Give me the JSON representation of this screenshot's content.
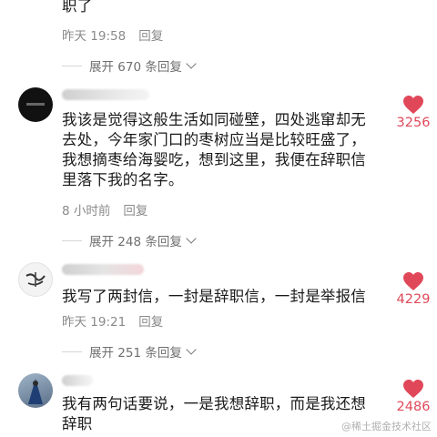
{
  "comments": [
    {
      "text_lines": [
        "职了"
      ],
      "time": "昨天 19:58",
      "reply_label": "回复",
      "expand_label": "展开 670 条回复"
    },
    {
      "text_lines": [
        "我该是觉得这般生活如同碰壁，四处逃窜却无",
        "去处，今年家门口的枣树应当是比较旺盛了，",
        "我想摘枣给海婴吃，想到这里，我便在辞职信",
        "里落下我的名字。"
      ],
      "time": "8 小时前",
      "reply_label": "回复",
      "like_count": "3256",
      "expand_label": "展开 248 条回复"
    },
    {
      "text_lines": [
        "我写了两封信，一封是辞职信，一封是举报信"
      ],
      "time": "昨天 19:21",
      "reply_label": "回复",
      "like_count": "4229",
      "expand_label": "展开 251 条回复"
    },
    {
      "text_lines": [
        "我有两句话要说，一是我想辞职，而是我还想",
        "辞职"
      ],
      "like_count": "2486"
    }
  ],
  "colors": {
    "like": "#e0485a",
    "meta": "#8a8a8a"
  },
  "icons": {
    "like": "heart-icon",
    "expand": "chevron-down-icon"
  },
  "watermark": "@稀土掘金技术社区"
}
